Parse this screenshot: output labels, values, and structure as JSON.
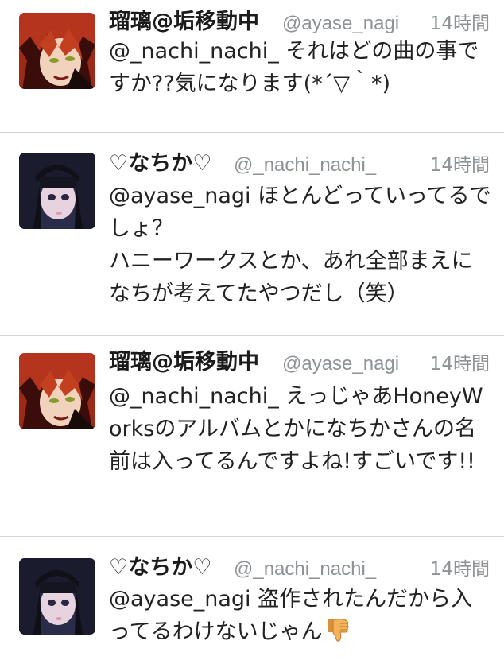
{
  "tweets": [
    {
      "display_name": "瑠璃@垢移動中",
      "handle": "@ayase_nagi",
      "time": "14時間",
      "text": "@_nachi_nachi_ それはどの曲の事ですか??気になります(*´▽｀*)"
    },
    {
      "display_name": "♡なちか♡",
      "handle": "@_nachi_nachi_",
      "time": "14時間",
      "text": "@ayase_nagi ほとんどっていってるでしょ？\nハニーワークスとか、あれ全部まえになちが考えてたやつだし（笑）"
    },
    {
      "display_name": "瑠璃@垢移動中",
      "handle": "@ayase_nagi",
      "time": "14時間",
      "text": "@_nachi_nachi_ えっじゃあHoneyWorksのアルバムとかになちかさんの名前は入ってるんですよね!すごいです!!"
    },
    {
      "display_name": "♡なちか♡",
      "handle": "@_nachi_nachi_",
      "time": "14時間",
      "text": "@ayase_nagi 盗作されたんだから入ってるわけないじゃん",
      "emoji": "thumbs-down-icon"
    }
  ]
}
